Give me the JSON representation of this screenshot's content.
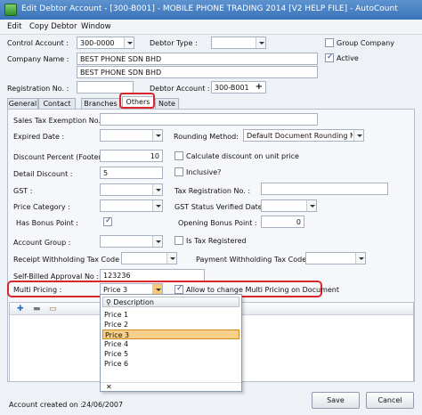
{
  "window": {
    "title": "Edit Debtor Account - [300-B001] - MOBILE PHONE TRADING 2014 [V2 HELP FILE] - AutoCount"
  },
  "menu": [
    "Edit",
    "Copy Debtor",
    "Window"
  ],
  "header": {
    "control_account_label": "Control Account :",
    "control_account_value": "300-0000",
    "debtor_type_label": "Debtor Type :",
    "debtor_type_value": "",
    "group_company_label": "Group Company",
    "group_company_checked": false,
    "company_name_label": "Company Name :",
    "company_name_1": "BEST PHONE SDN BHD",
    "company_name_2": "BEST PHONE SDN BHD",
    "active_label": "Active",
    "active_checked": true,
    "registration_no_label": "Registration No. :",
    "registration_no_value": "",
    "debtor_account_label": "Debtor Account :",
    "debtor_account_value": "300-B001",
    "debtor_account_icon": "plus-icon"
  },
  "tabs": [
    "General",
    "Contact",
    "Branches",
    "Others",
    "Note"
  ],
  "active_tab": "Others",
  "others": {
    "sales_tax_exemption_label": "Sales Tax Exemption No. :",
    "sales_tax_exemption_value": "",
    "expired_date_label": "Expired Date :",
    "expired_date_value": "",
    "rounding_method_label": "Rounding Method:",
    "rounding_method_value": "Default Document Rounding Method",
    "discount_percent_label": "Discount Percent (Footer):",
    "discount_percent_value": "10",
    "calc_discount_label": "Calculate discount on unit price",
    "calc_discount_checked": false,
    "detail_discount_label": "Detail Discount :",
    "detail_discount_value": "5",
    "inclusive_label": "Inclusive?",
    "inclusive_checked": false,
    "gst_label": "GST :",
    "gst_value": "",
    "tax_registration_label": "Tax Registration No. :",
    "tax_registration_value": "",
    "price_category_label": "Price Category :",
    "price_category_value": "",
    "gst_status_date_label": "GST Status Verified Date :",
    "gst_status_date_value": "",
    "has_bonus_point_label": "Has Bonus Point :",
    "has_bonus_point_checked": true,
    "opening_bonus_point_label": "Opening Bonus Point :",
    "opening_bonus_point_value": "0",
    "account_group_label": "Account Group :",
    "account_group_value": "",
    "is_tax_registered_label": "Is Tax Registered",
    "is_tax_registered_checked": false,
    "receipt_withholding_label": "Receipt Withholding Tax Code :",
    "receipt_withholding_value": "",
    "payment_withholding_label": "Payment Withholding Tax Code :",
    "payment_withholding_value": "",
    "self_billed_label": "Self-Billed Approval No :",
    "self_billed_value": "123236",
    "multi_pricing_label": "Multi Pricing :",
    "multi_pricing_value": "Price 3",
    "allow_change_label": "Allow to change Multi Pricing on Document",
    "allow_change_checked": true
  },
  "dropdown": {
    "header": "Description",
    "header_icon": "binoculars-icon",
    "items": [
      "Price 1",
      "Price 2",
      "Price 3",
      "Price 4",
      "Price 5",
      "Price 6"
    ],
    "selected": "Price 3",
    "footer": "✕"
  },
  "grid_toolbar": {
    "add_icon": "plus-icon",
    "remove_icon": "minus-icon",
    "folder_icon": "folder-icon"
  },
  "footer": {
    "account_created_label": "Account created on :",
    "account_created_value": "24/06/2007",
    "save_label": "Save",
    "cancel_label": "Cancel"
  },
  "colors": {
    "highlight": "#d9262c",
    "selected_item": "#f8d089",
    "titlebar": "#3a73b8"
  }
}
